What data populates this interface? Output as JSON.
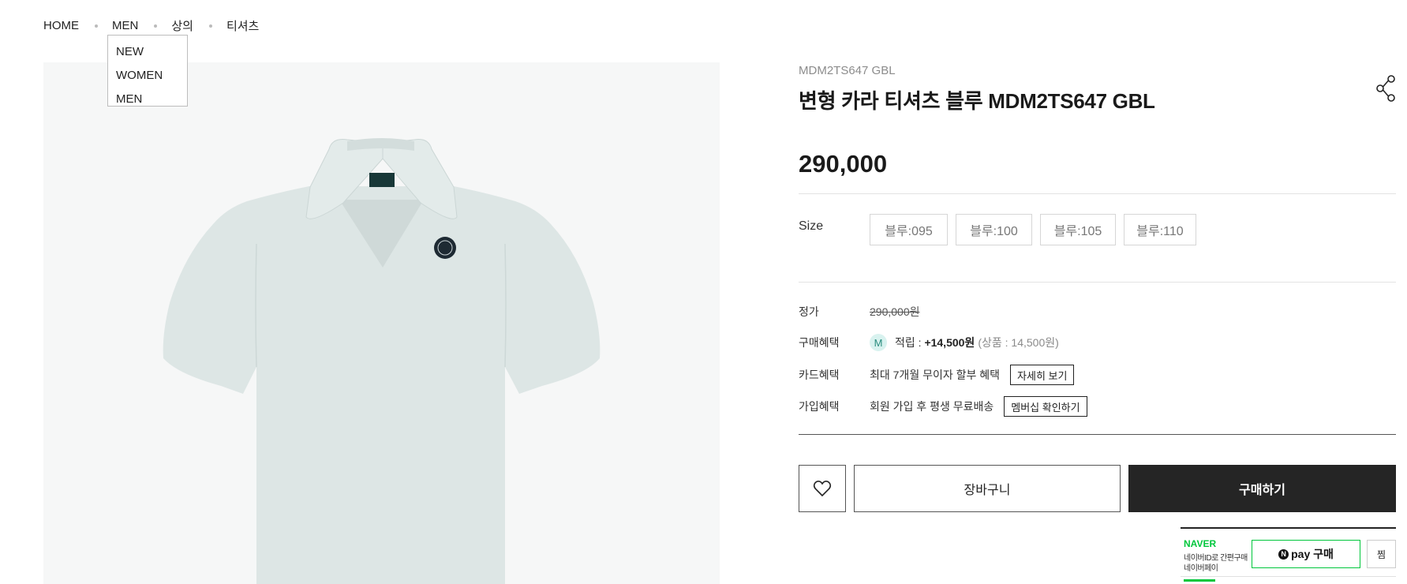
{
  "breadcrumb": {
    "items": [
      "HOME",
      "MEN",
      "상의",
      "티셔츠"
    ]
  },
  "dropdown": {
    "items": [
      "NEW",
      "WOMEN",
      "MEN"
    ]
  },
  "product": {
    "code": "MDM2TS647 GBL",
    "title": "변형 카라 티셔츠 블루 MDM2TS647 GBL",
    "price": "290,000",
    "garment_color": "#dde6e5"
  },
  "size": {
    "label": "Size",
    "options": [
      "블루:095",
      "블루:100",
      "블루:105",
      "블루:110"
    ]
  },
  "details": {
    "list_price_label": "정가",
    "list_price": "290,000원",
    "purchase_benefit_label": "구매혜택",
    "member_badge": "M",
    "points_prefix": "적립 :",
    "points_value": "+14,500원",
    "points_detail": "(상품 : 14,500원)",
    "card_benefit_label": "카드혜택",
    "card_benefit_text": "최대 7개월 무이자 할부 혜택",
    "card_benefit_button": "자세히 보기",
    "join_benefit_label": "가입혜택",
    "join_benefit_text": "회원 가입 후 평생 무료배송",
    "join_benefit_button": "멤버십 확인하기"
  },
  "actions": {
    "wishlist_icon": "heart-icon",
    "cart_label": "장바구니",
    "buy_label": "구매하기",
    "buy_color": "#252525"
  },
  "naver_pay": {
    "brand": "NAVER",
    "sub1": "네이버ID로 간편구매",
    "sub2": "네이버페이",
    "n_mark": "N",
    "pay_label": "pay 구매",
    "zzim_label": "찜",
    "brand_color": "#00c73c"
  },
  "icons": {
    "share": "share-icon",
    "heart": "heart-icon"
  }
}
